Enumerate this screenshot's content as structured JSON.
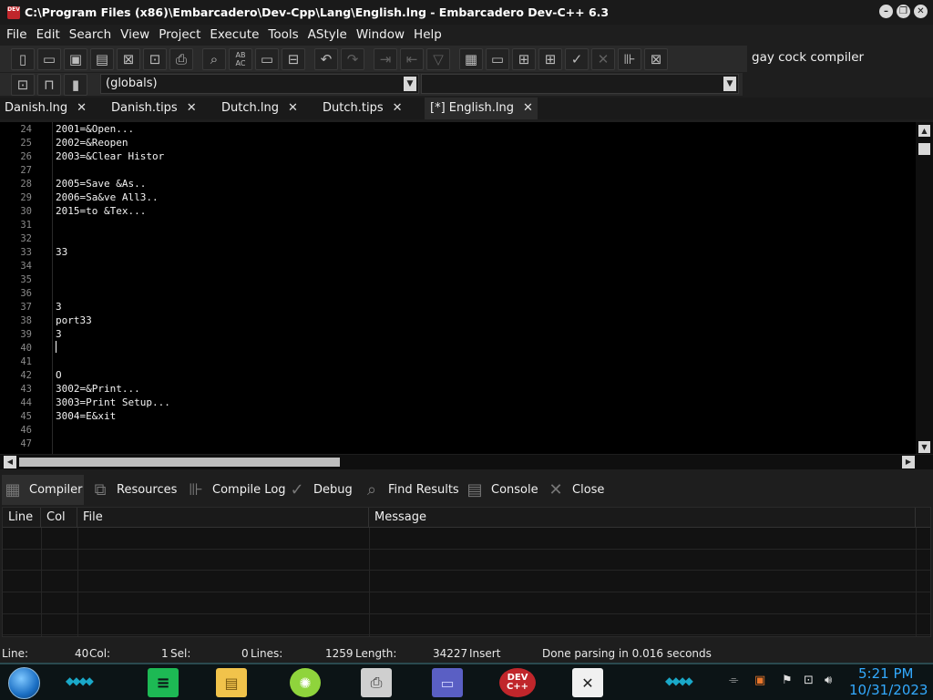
{
  "window": {
    "title": "C:\\Program Files (x86)\\Embarcadero\\Dev-Cpp\\Lang\\English.lng - Embarcadero Dev-C++ 6.3",
    "app_icon_text": "DEV"
  },
  "menu": [
    "File",
    "Edit",
    "Search",
    "View",
    "Project",
    "Execute",
    "Tools",
    "AStyle",
    "Window",
    "Help"
  ],
  "toolbar": {
    "compiler_name": "gay cock compiler",
    "globals_select": "(globals)",
    "second_select": ""
  },
  "tabs": [
    {
      "label": "Danish.lng",
      "active": false
    },
    {
      "label": "Danish.tips",
      "active": false
    },
    {
      "label": "Dutch.lng",
      "active": false
    },
    {
      "label": "Dutch.tips",
      "active": false
    },
    {
      "label": "[*] English.lng",
      "active": true
    }
  ],
  "editor": {
    "lines": [
      {
        "num": "24",
        "text": "2001=&Open..."
      },
      {
        "num": "25",
        "text": "2002=&Reopen"
      },
      {
        "num": "26",
        "text": "2003=&Clear Histor"
      },
      {
        "num": "27",
        "text": ""
      },
      {
        "num": "28",
        "text": "2005=Save &As.."
      },
      {
        "num": "29",
        "text": "2006=Sa&ve All3.."
      },
      {
        "num": "30",
        "text": "2015=to &Tex..."
      },
      {
        "num": "31",
        "text": ""
      },
      {
        "num": "32",
        "text": ""
      },
      {
        "num": "33",
        "text": "33"
      },
      {
        "num": "34",
        "text": ""
      },
      {
        "num": "35",
        "text": ""
      },
      {
        "num": "36",
        "text": ""
      },
      {
        "num": "37",
        "text": "3"
      },
      {
        "num": "38",
        "text": "port33"
      },
      {
        "num": "39",
        "text": "3"
      },
      {
        "num": "40",
        "text": ""
      },
      {
        "num": "41",
        "text": ""
      },
      {
        "num": "42",
        "text": "O"
      },
      {
        "num": "43",
        "text": "3002=&Print..."
      },
      {
        "num": "44",
        "text": "3003=Print Setup..."
      },
      {
        "num": "45",
        "text": "3004=E&xit"
      },
      {
        "num": "46",
        "text": ""
      },
      {
        "num": "47",
        "text": ""
      }
    ]
  },
  "bottom_tabs": [
    {
      "label": "Compiler",
      "icon": "compiler-grid-icon",
      "active": true
    },
    {
      "label": "Resources",
      "icon": "resources-icon",
      "active": false
    },
    {
      "label": "Compile Log",
      "icon": "compile-log-chart-icon",
      "active": false
    },
    {
      "label": "Debug",
      "icon": "debug-check-icon",
      "active": false
    },
    {
      "label": "Find Results",
      "icon": "find-results-icon",
      "active": false
    },
    {
      "label": "Console",
      "icon": "console-icon",
      "active": false
    },
    {
      "label": "Close",
      "icon": "close-x-icon",
      "active": false
    }
  ],
  "grid": {
    "columns": [
      "Line",
      "Col",
      "File",
      "Message"
    ]
  },
  "status": {
    "line_label": "Line:",
    "line_value": "40",
    "col_label": "Col:",
    "col_value": "1",
    "sel_label": "Sel:",
    "sel_value": "0",
    "lines_label": "Lines:",
    "lines_value": "1259",
    "length_label": "Length:",
    "length_value": "34227",
    "mode": "Insert",
    "message": "Done parsing in 0.016 seconds"
  },
  "taskbar": {
    "apps": [
      "spotify-icon",
      "file-explorer-icon",
      "lime-app-icon",
      "printer-app-icon",
      "card-app-icon",
      "devcpp-icon",
      "notepad-app-icon"
    ],
    "devcpp_icon_text": "DEV C++",
    "time": "5:21 PM",
    "date": "10/31/2023"
  },
  "colors": {
    "background": "#1e1e1e",
    "editor_bg": "#000000",
    "clock": "#33aaff",
    "accent_teal": "#1aa8c8",
    "devcpp_red": "#c0262b"
  }
}
